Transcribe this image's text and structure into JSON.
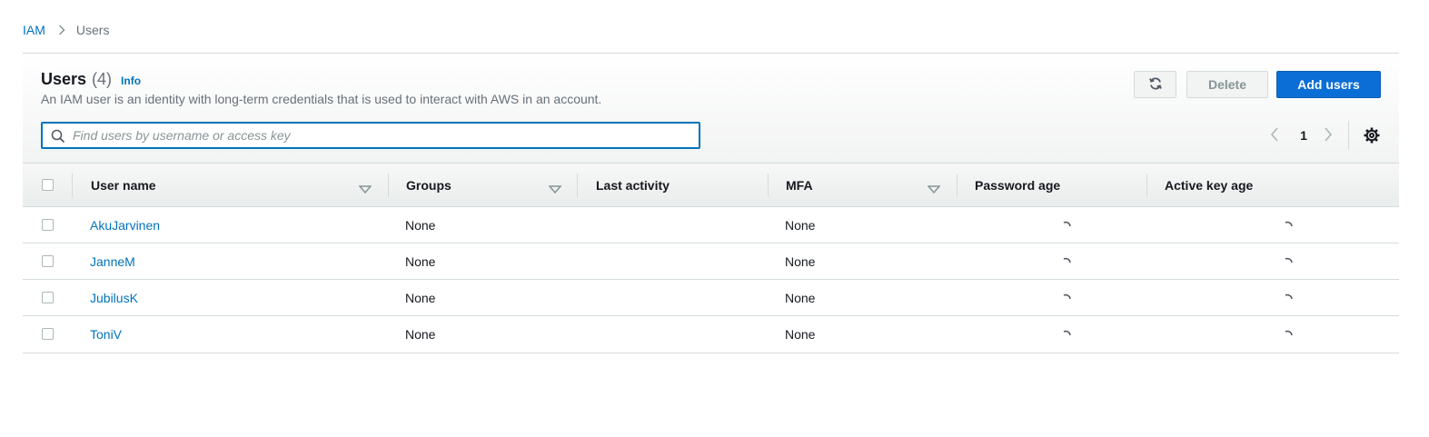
{
  "breadcrumb": {
    "root": "IAM",
    "current": "Users"
  },
  "header": {
    "title": "Users",
    "count": "(4)",
    "info": "Info",
    "description": "An IAM user is an identity with long-term credentials that is used to interact with AWS in an account."
  },
  "actions": {
    "refresh_icon": "refresh-icon",
    "delete_label": "Delete",
    "add_label": "Add users"
  },
  "search": {
    "placeholder": "Find users by username or access key",
    "value": ""
  },
  "pagination": {
    "current_page": "1"
  },
  "table": {
    "columns": {
      "user_name": "User name",
      "groups": "Groups",
      "last_activity": "Last activity",
      "mfa": "MFA",
      "password_age": "Password age",
      "active_key_age": "Active key age"
    },
    "rows": [
      {
        "user_name": "AkuJarvinen",
        "groups": "None",
        "last_activity": "",
        "mfa": "None"
      },
      {
        "user_name": "JanneM",
        "groups": "None",
        "last_activity": "",
        "mfa": "None"
      },
      {
        "user_name": "JubilusK",
        "groups": "None",
        "last_activity": "",
        "mfa": "None"
      },
      {
        "user_name": "ToniV",
        "groups": "None",
        "last_activity": "",
        "mfa": "None"
      }
    ]
  },
  "colors": {
    "link": "#0073bb",
    "primary_button": "#0b6ed6",
    "border": "#d5dbdb",
    "muted_text": "#687078"
  }
}
